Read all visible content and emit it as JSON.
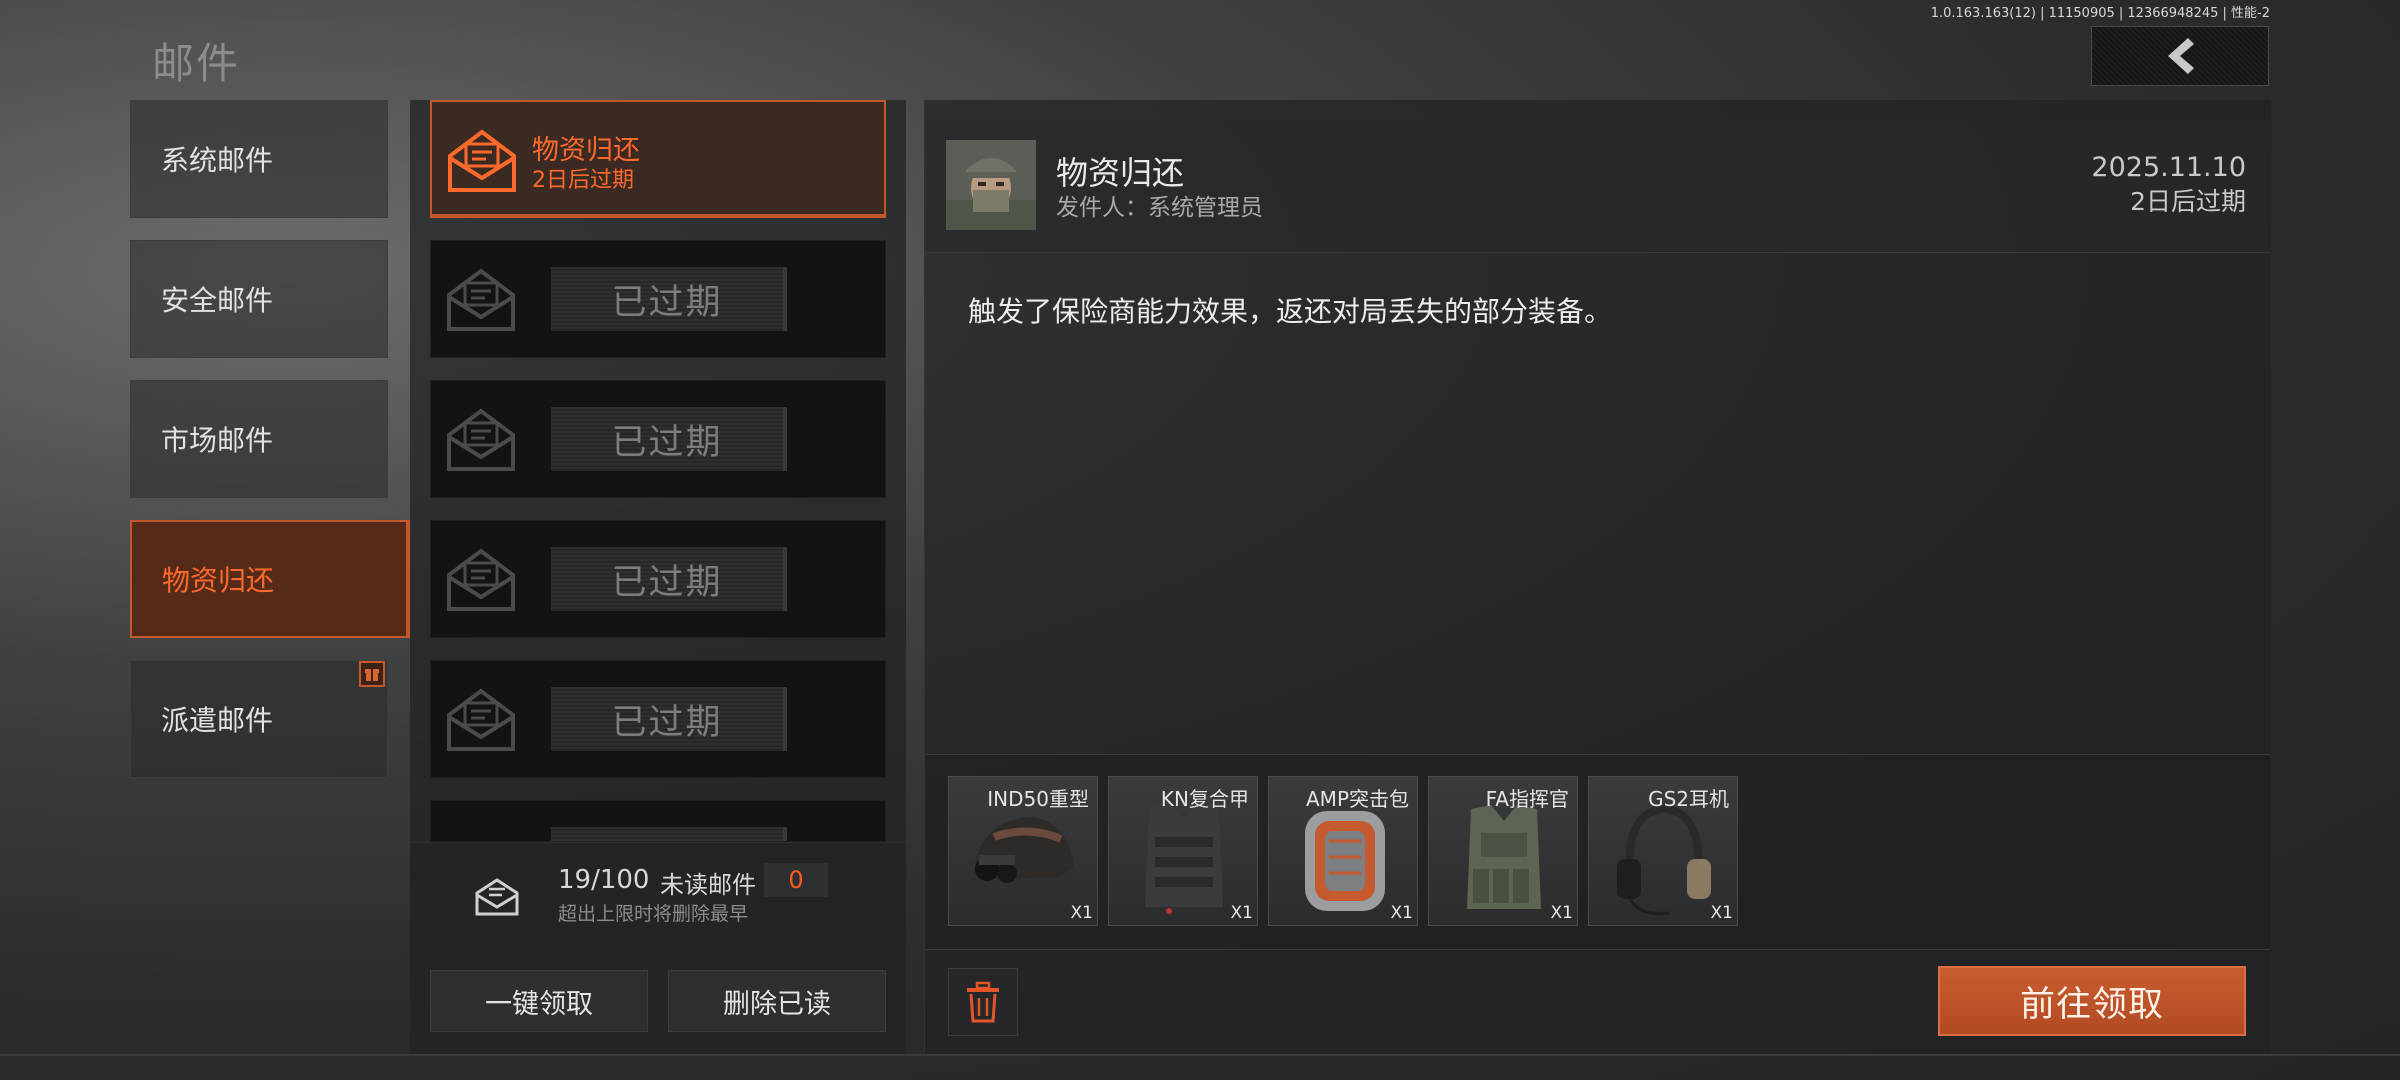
{
  "version_info": "1.0.163.163(12) | 11150905 | 12366948245 | 性能-2",
  "page_title": "邮件",
  "categories": [
    {
      "label": "系统邮件",
      "active": false
    },
    {
      "label": "安全邮件",
      "active": false
    },
    {
      "label": "市场邮件",
      "active": false
    },
    {
      "label": "物资归还",
      "active": true
    },
    {
      "label": "派遣邮件",
      "active": false,
      "badge": "gift-icon"
    }
  ],
  "mail_list": {
    "active_item": {
      "title": "物资归还",
      "expiry": "2日后过期"
    },
    "expired_label": "已过期"
  },
  "mailbox_stats": {
    "count": "19/100",
    "unread_label": "未读邮件",
    "unread_count": "0",
    "hint": "超出上限时将删除最早"
  },
  "buttons": {
    "claim_all": "一键领取",
    "delete_read": "删除已读",
    "claim": "前往领取"
  },
  "mail_detail": {
    "title": "物资归还",
    "sender": "发件人：系统管理员",
    "date": "2025.11.10",
    "expiry": "2日后过期",
    "body": "触发了保险商能力效果，返还对局丢失的部分装备。"
  },
  "attachments": [
    {
      "name": "IND50重型",
      "qty": "X1",
      "icon": "helmet-icon"
    },
    {
      "name": "KN复合甲",
      "qty": "X1",
      "icon": "armor-vest-icon"
    },
    {
      "name": "AMP突击包",
      "qty": "X1",
      "icon": "backpack-icon"
    },
    {
      "name": "FA指挥官",
      "qty": "X1",
      "icon": "chest-rig-icon"
    },
    {
      "name": "GS2耳机",
      "qty": "X1",
      "icon": "headset-icon"
    }
  ],
  "colors": {
    "accent": "#c4572c",
    "accent_text": "#ff6a2c",
    "claim_button": "#b9512a"
  }
}
